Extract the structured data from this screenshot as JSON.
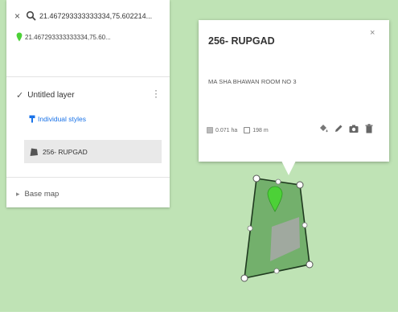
{
  "search": {
    "close_glyph": "×",
    "query": "21.467293333333334,75.602214..."
  },
  "result": {
    "text": "21.467293333333334,75.60..."
  },
  "layer": {
    "check_glyph": "✓",
    "title": "Untitled layer",
    "styles_link": "Individual styles",
    "feature_label": "256- RUPGAD"
  },
  "basemap": {
    "chevron": "▸",
    "label": "Base map"
  },
  "popup": {
    "close_glyph": "×",
    "title": "256- RUPGAD",
    "description": "MA SHA BHAWAN ROOM NO 3",
    "area": "0.071 ha",
    "perimeter": "198 m"
  },
  "icons": [
    "close-icon",
    "search-icon",
    "location-pin-icon",
    "kebab-menu-icon",
    "paint-brush-icon",
    "polygon-icon",
    "chevron-right-icon",
    "area-icon",
    "perimeter-icon",
    "style-bucket-icon",
    "edit-pencil-icon",
    "camera-icon",
    "trash-icon"
  ],
  "colors": {
    "map_background": "#bfe3b5",
    "polygon_fill": "#6aaa64",
    "polygon_stroke": "#1f3a1f",
    "marker": "#4cd137",
    "link": "#1a73e8"
  }
}
